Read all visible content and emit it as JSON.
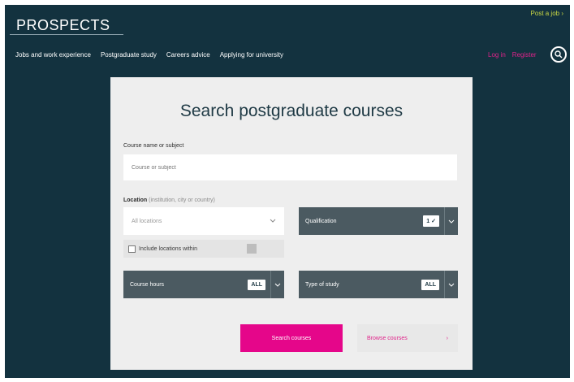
{
  "header": {
    "logo_text": "PROSPECTS",
    "post_job_label": "Post a job ›",
    "login_label": "Log in",
    "register_label": "Register",
    "search_icon": "search-icon"
  },
  "nav": {
    "items": [
      {
        "label": "Jobs and work experience"
      },
      {
        "label": "Postgraduate study"
      },
      {
        "label": "Careers advice"
      },
      {
        "label": "Applying for university"
      }
    ]
  },
  "search_form": {
    "title": "Search postgraduate courses",
    "subject_label": "Course name or subject",
    "subject_placeholder": "Course or subject",
    "location_label": "Location",
    "location_hint": "(institution, city or country)",
    "location_placeholder": "All locations",
    "within_label": "Include locations within",
    "qualification_label": "Qualification",
    "qualification_value": "1 ✓",
    "course_hours_label": "Course hours",
    "course_hours_value": "ALL",
    "type_of_study_label": "Type of study",
    "type_of_study_value": "ALL",
    "search_button_label": "Search courses",
    "browse_button_label": "Browse courses",
    "browse_chevron": "›"
  },
  "colors": {
    "background": "#13323f",
    "accent_pink": "#e5068a",
    "post_job_green": "#cbd944",
    "dropdown_dark": "#4b5a61"
  }
}
